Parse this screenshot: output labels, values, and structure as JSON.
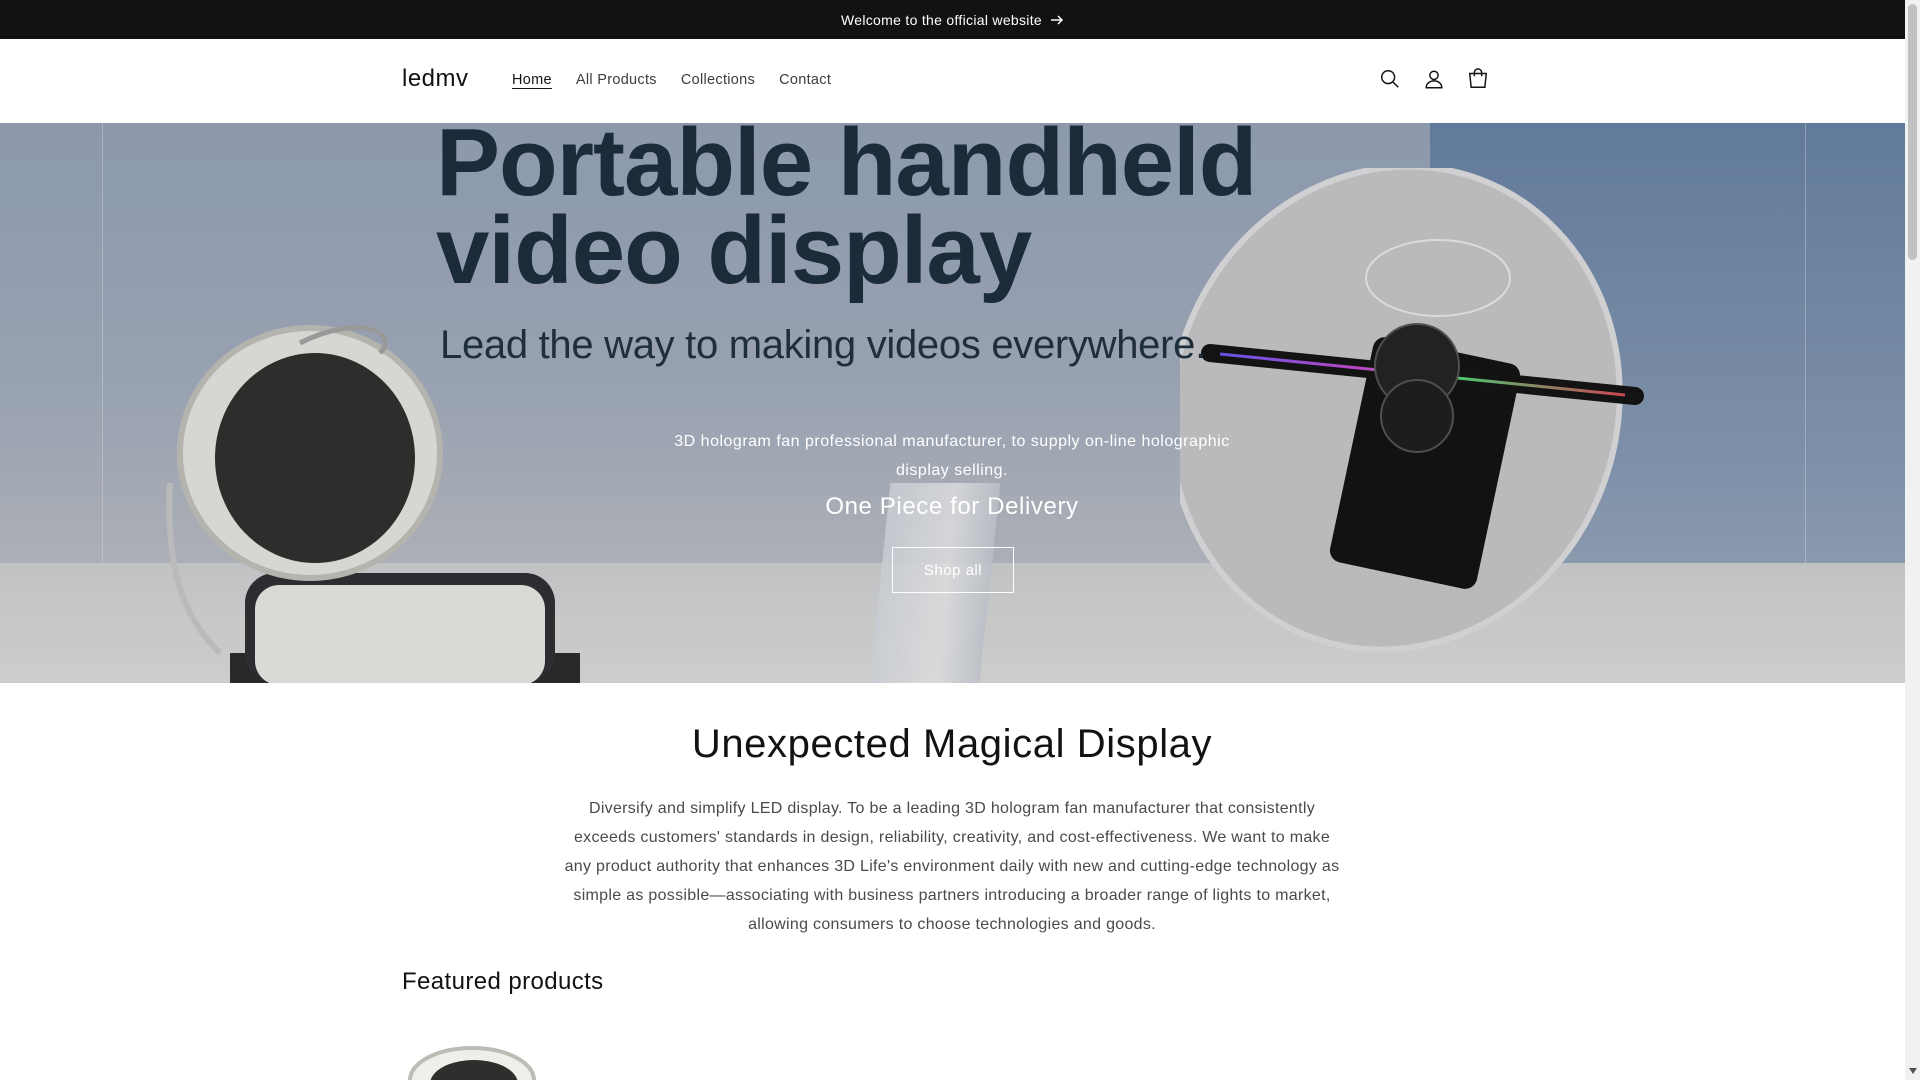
{
  "announcement": {
    "text": "Welcome to the official website",
    "icon": "arrow-right-icon"
  },
  "header": {
    "logo": "ledmv",
    "nav": [
      {
        "label": "Home",
        "active": true
      },
      {
        "label": "All Products",
        "active": false
      },
      {
        "label": "Collections",
        "active": false
      },
      {
        "label": "Contact",
        "active": false
      }
    ],
    "icons": [
      "search-icon",
      "account-icon",
      "cart-icon"
    ]
  },
  "hero": {
    "image_headline_line1": "Portable handheld",
    "image_headline_line2": "video display",
    "image_subheadline": "Lead the way to making videos everywhere.",
    "text": "3D hologram fan professional manufacturer, to supply on-line holographic display selling.",
    "delivery": "One Piece for Delivery",
    "button_label": "Shop all"
  },
  "magic": {
    "title": "Unexpected Magical Display",
    "text": "Diversify and simplify LED display. To be a leading 3D hologram fan manufacturer that consistently exceeds customers' standards in design, reliability, creativity, and cost-effectiveness. We want to make any product authority that enhances 3D Life's environment daily with new and cutting-edge technology as simple as possible—associating with business partners introducing a broader range of lights to market, allowing consumers to choose technologies and goods."
  },
  "featured": {
    "title": "Featured products"
  },
  "colors": {
    "announcement_bg": "#121212",
    "hero_text": "#1a2c3d",
    "body_text": "#121212"
  }
}
